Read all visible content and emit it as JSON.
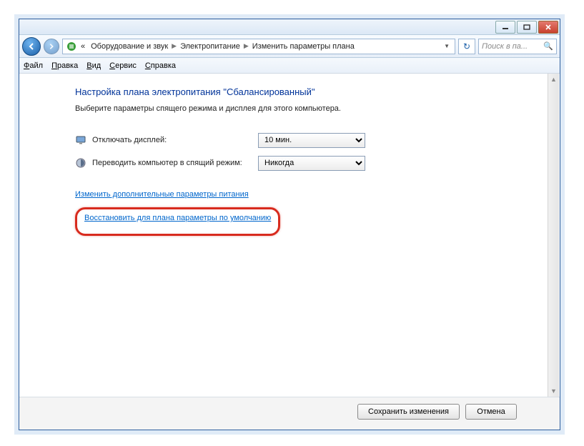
{
  "titlebar": {
    "minimize": "minimize",
    "maximize": "maximize",
    "close": "close"
  },
  "breadcrumb": {
    "prefix": "«",
    "items": [
      "Оборудование и звук",
      "Электропитание",
      "Изменить параметры плана"
    ]
  },
  "search": {
    "placeholder": "Поиск в па..."
  },
  "menu": {
    "file": "Файл",
    "edit": "Правка",
    "view": "Вид",
    "tools": "Сервис",
    "help": "Справка"
  },
  "page": {
    "heading": "Настройка плана электропитания \"Сбалансированный\"",
    "subheading": "Выберите параметры спящего режима и дисплея для этого компьютера."
  },
  "settings": {
    "display_off_label": "Отключать дисплей:",
    "display_off_value": "10 мин.",
    "sleep_label": "Переводить компьютер в спящий режим:",
    "sleep_value": "Никогда"
  },
  "links": {
    "advanced": "Изменить дополнительные параметры питания",
    "restore": "Восстановить для плана параметры по умолчанию"
  },
  "buttons": {
    "save": "Сохранить изменения",
    "cancel": "Отмена"
  }
}
